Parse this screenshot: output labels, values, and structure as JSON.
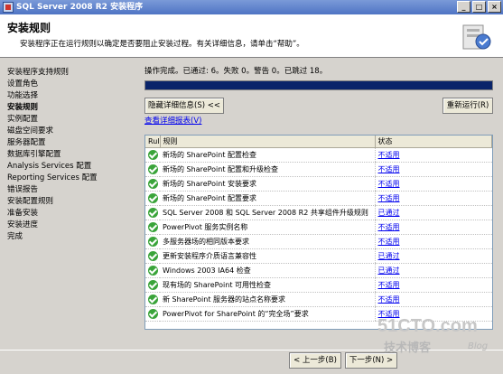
{
  "window": {
    "title": "SQL Server 2008 R2 安装程序"
  },
  "header": {
    "title": "安装规则",
    "description": "安装程序正在运行规则以确定是否要阻止安装过程。有关详细信息，请单击“帮助”。"
  },
  "nav": [
    {
      "label": "安装程序支持规则",
      "active": false
    },
    {
      "label": "设置角色",
      "active": false
    },
    {
      "label": "功能选择",
      "active": false
    },
    {
      "label": "安装规则",
      "active": true
    },
    {
      "label": "实例配置",
      "active": false
    },
    {
      "label": "磁盘空间要求",
      "active": false
    },
    {
      "label": "服务器配置",
      "active": false
    },
    {
      "label": "数据库引擎配置",
      "active": false
    },
    {
      "label": "Analysis Services 配置",
      "active": false
    },
    {
      "label": "Reporting Services 配置",
      "active": false
    },
    {
      "label": "错误报告",
      "active": false
    },
    {
      "label": "安装配置规则",
      "active": false
    },
    {
      "label": "准备安装",
      "active": false
    },
    {
      "label": "安装进度",
      "active": false
    },
    {
      "label": "完成",
      "active": false
    }
  ],
  "main": {
    "status_text": "操作完成。已通过: 6。失败 0。警告 0。已跳过 18。",
    "progress_percent": 100,
    "hide_details_label": "隐藏详细信息(S) <<",
    "rerun_label": "重新运行(R)",
    "view_report_label": "查看详细报表(V)",
    "columns": {
      "col1": "Rul",
      "col2": "规则",
      "col3": "状态"
    },
    "rows": [
      {
        "rule": "新场的 SharePoint 配置检查",
        "status": "不适用"
      },
      {
        "rule": "新场的 SharePoint 配置和升级检查",
        "status": "不适用"
      },
      {
        "rule": "新场的 SharePoint 安装要求",
        "status": "不适用"
      },
      {
        "rule": "新场的 SharePoint 配置要求",
        "status": "不适用"
      },
      {
        "rule": "SQL Server 2008 和 SQL Server 2008 R2 共享组件升级规则",
        "status": "已通过"
      },
      {
        "rule": "PowerPivot 服务实例名称",
        "status": "不适用"
      },
      {
        "rule": "多服务器场的相同版本要求",
        "status": "不适用"
      },
      {
        "rule": "更新安装程序介质语言兼容性",
        "status": "已通过"
      },
      {
        "rule": "Windows 2003 IA64 检查",
        "status": "已通过"
      },
      {
        "rule": "现有场的 SharePoint 可用性检查",
        "status": "不适用"
      },
      {
        "rule": "新 SharePoint 服务器的站点名称要求",
        "status": "不适用"
      },
      {
        "rule": "PowerPivot for SharePoint 的“完全场”要求",
        "status": "不适用"
      }
    ]
  },
  "footer": {
    "back_label": "< 上一步(B)",
    "next_label": "下一步(N) >"
  },
  "watermark": {
    "site": "51CTO.com",
    "sub": "技术博客",
    "blog": "Blog"
  }
}
